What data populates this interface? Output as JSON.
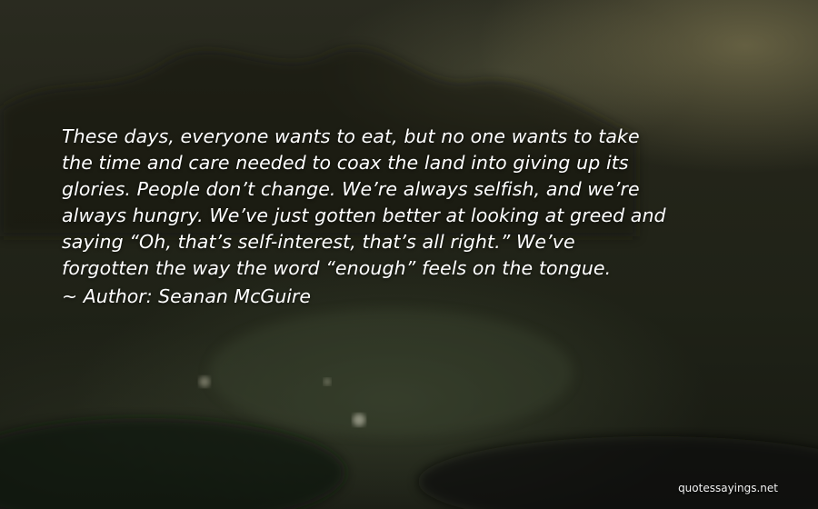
{
  "quote": {
    "lines": [
      "These days, everyone wants to eat, but no one wants to take",
      "the time and care needed to coax the land into giving up its",
      "glories. People don’t change. We’re always selfish, and we’re",
      "always hungry. We’ve just gotten better at looking at greed and",
      "saying “Oh, that’s self-interest, that’s all right.” We’ve",
      "forgotten the way the word “enough” feels on the tongue."
    ],
    "author_line": "~ Author: Seanan McGuire"
  },
  "watermark": "quotessayings.net",
  "colors": {
    "text": "#ffffff",
    "background_dark": "#1b1d14",
    "background_glow": "#968c5f"
  }
}
